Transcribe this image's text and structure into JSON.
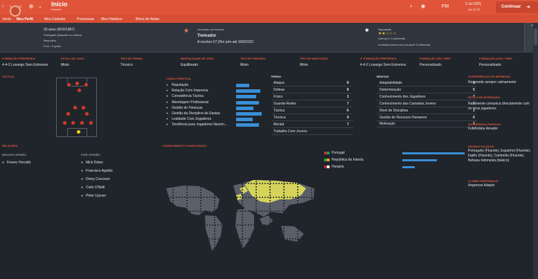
{
  "header": {
    "title": "Início",
    "subtitle": "Honvéd",
    "date": "2 Jul 2021",
    "time": "Qui 21:00",
    "continue": "Continuar"
  },
  "tabs": [
    "Início",
    "Meu Perfil",
    "Meu Contrato",
    "Promessas",
    "Meu Histórico",
    "Bloco de Notas"
  ],
  "profile": {
    "age": "33 anos (8/10/1987)",
    "nation": "Português (Nascido no Lisboa)",
    "gender": "Masculino",
    "stats": "0 int. / 0 golos"
  },
  "job": {
    "label": "Vinculado ao Honvéd",
    "role": "Treinador",
    "salary": "A receber €7,25m p/m até 30/6/2022"
  },
  "reputation": {
    "label": "Reputação",
    "stars": "★★☆☆☆",
    "licence": "Licença C Continental",
    "course": "A estudar para uma Licença B Continental"
  },
  "prefs": [
    {
      "label": "FORMAÇÃO PREFERIDA",
      "value": "4-4-2 Losango Sem Extremos"
    },
    {
      "label": "ESTILO DE JOGO",
      "value": "Misto"
    },
    {
      "label": "TIPO DE TREINO",
      "value": "Técnico"
    },
    {
      "label": "MENTALIDADE DE JOGO",
      "value": "Equilibrado"
    },
    {
      "label": "TIPO DE PRESSÃO",
      "value": "Misto"
    },
    {
      "label": "TIPO DE MARCAÇÃO",
      "value": "Misto"
    },
    {
      "label": "2ª FORMAÇÃO PREFERIDA",
      "value": "4-4-2 Losango Sem Extremos"
    },
    {
      "label": "FORMAÇÃO DEF. PREF.",
      "value": "Personalizado"
    },
    {
      "label": "FORMAÇÃO ATAC. PREF.",
      "value": "Personalizado"
    }
  ],
  "sections": {
    "tactics": "TÁCTICA",
    "characteristics": "CARACTERÍSTICA",
    "training": "TREINO",
    "mental": "MENTAIS",
    "relations": "RELAÇÕES",
    "best": "MELHOR OPINIÃO",
    "worst": "PIOR OPINIÃO",
    "knowledge": "CONHECIMENTO CONSOLIDADO",
    "media": "CONFERÊNCIAS DE IMPRENSA",
    "interaction": "ESTILO DE INTERAÇÃO",
    "past": "EXPERIÊNCIA PASSADA",
    "languages": "IDIOMAS FALADOS",
    "favourite": "CLUBES PREFERIDOS"
  },
  "characteristics": [
    {
      "name": "Reputação",
      "pct": 42
    },
    {
      "name": "Relação Com Imprensa",
      "pct": 77
    },
    {
      "name": "Consistência Táctica",
      "pct": 65
    },
    {
      "name": "Abordagem Profissional",
      "pct": 73
    },
    {
      "name": "Gestão de Finanças",
      "pct": 55
    },
    {
      "name": "Gestão da Disciplina de Equipa",
      "pct": 82
    },
    {
      "name": "Lealdade Com Jogadores",
      "pct": 54
    },
    {
      "name": "Tendência para Jogadores Nacion...",
      "pct": 73
    }
  ],
  "training": [
    {
      "name": "Ataque",
      "value": "8"
    },
    {
      "name": "Defesa",
      "value": "8"
    },
    {
      "name": "Físico",
      "value": "3"
    },
    {
      "name": "Guarda-Redes",
      "value": "7"
    },
    {
      "name": "Táctica",
      "value": "6"
    },
    {
      "name": "Técnica",
      "value": "9"
    },
    {
      "name": "Mental",
      "value": "7"
    },
    {
      "name": "Trabalho Com Jovens",
      "value": ""
    }
  ],
  "mental": [
    {
      "name": "Adaptabilidade",
      "value": "2"
    },
    {
      "name": "Determinação",
      "value": "5"
    },
    {
      "name": "Conhecimento dos Jogadores",
      "value": "7"
    },
    {
      "name": "Conhecimento das Camadas Jovens",
      "value": "7"
    },
    {
      "name": "Nível de Disciplina",
      "value": "1"
    },
    {
      "name": "Gestão de Recursos Humanos",
      "value": "6"
    },
    {
      "name": "Motivação",
      "value": "7"
    }
  ],
  "bestOpinion": [
    "Ferenc Horváth"
  ],
  "worstOpinion": [
    "Mick Dolan",
    "Francisco Agatão",
    "Dinny Corcoran",
    "Colin O'Neill",
    "Péter Lipcsei"
  ],
  "countries": [
    {
      "name": "Portugal",
      "pct": 100
    },
    {
      "name": "República da Irlanda",
      "pct": 55
    },
    {
      "name": "Hungria",
      "pct": 20
    }
  ],
  "right": {
    "media": "Responde sempre calmamente",
    "interaction": "Raramente comunica directamente com os seus jogadores",
    "past": "Futebolista Amador",
    "languages": "Português (Fluente), Espanhol (Fluente), Inglês (Fluente), Cantonês (Fluente), Bahasa Indonesia (básico)",
    "favourite": "Angrense Adepto"
  },
  "colors": {
    "accent": "#e0553a",
    "bar": "#3a8fd6"
  }
}
